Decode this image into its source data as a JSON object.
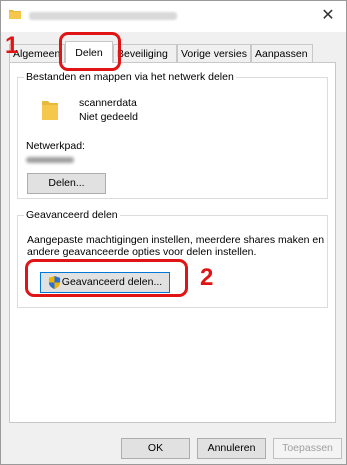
{
  "tabs": [
    "Algemeen",
    "Delen",
    "Beveiliging",
    "Vorige versies",
    "Aanpassen"
  ],
  "network_share": {
    "group_title": "Bestanden en mappen via het netwerk delen",
    "folder_name": "scannerdata",
    "share_status": "Niet gedeeld",
    "network_path_label": "Netwerkpad:",
    "share_button": "Delen..."
  },
  "advanced_share": {
    "group_title": "Geavanceerd delen",
    "description": "Aangepaste machtigingen instellen, meerdere shares maken en andere geavanceerde opties voor delen instellen.",
    "button": "Geavanceerd delen..."
  },
  "footer": {
    "ok": "OK",
    "cancel": "Annuleren",
    "apply": "Toepassen"
  },
  "markers": {
    "step1": "1",
    "step2": "2"
  },
  "colors": {
    "highlight": "#e01414",
    "folder": "#f5c74a"
  }
}
